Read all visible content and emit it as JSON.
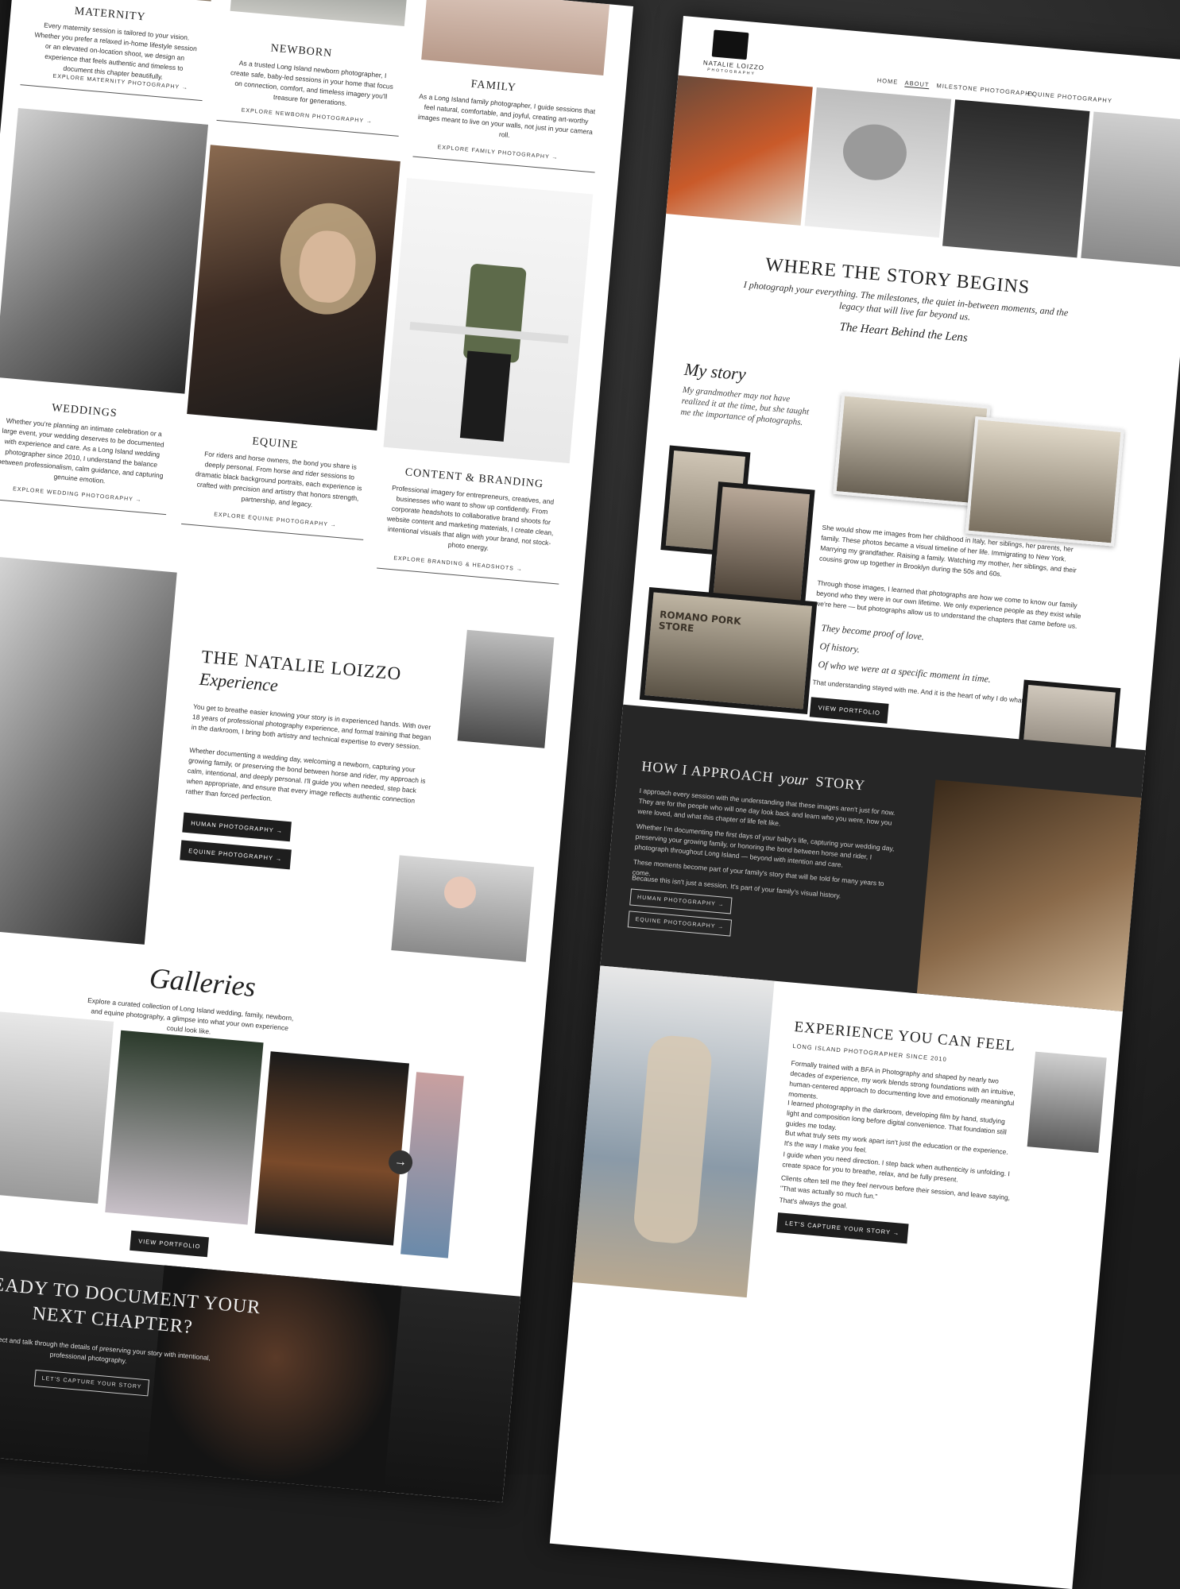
{
  "left": {
    "services_top": [
      {
        "title": "MATERNITY",
        "desc": "Every maternity session is tailored to your vision. Whether you prefer a relaxed in-home lifestyle session or an elevated on-location shoot, we design an experience that feels authentic and timeless to document this chapter beautifully.",
        "link": "EXPLORE MATERNITY PHOTOGRAPHY →"
      },
      {
        "title": "NEWBORN",
        "desc": "As a trusted Long Island newborn photographer, I create safe, baby-led sessions in your home that focus on connection, comfort, and timeless imagery you'll treasure for generations.",
        "link": "EXPLORE NEWBORN PHOTOGRAPHY →"
      },
      {
        "title": "FAMILY",
        "desc": "As a Long Island family photographer, I guide sessions that feel natural, comfortable, and joyful, creating art-worthy images meant to live on your walls, not just in your camera roll.",
        "link": "EXPLORE FAMILY PHOTOGRAPHY →"
      }
    ],
    "services_bottom": [
      {
        "title": "WEDDINGS",
        "desc": "Whether you're planning an intimate celebration or a large event, your wedding deserves to be documented with experience and care. As a Long Island wedding photographer since 2010, I understand the balance between professionalism, calm guidance, and capturing genuine emotion.",
        "link": "EXPLORE WEDDING PHOTOGRAPHY →"
      },
      {
        "title": "EQUINE",
        "desc": "For riders and horse owners, the bond you share is deeply personal. From horse and rider sessions to dramatic black background portraits, each experience is crafted with precision and artistry that honors strength, partnership, and legacy.",
        "link": "EXPLORE EQUINE PHOTOGRAPHY →"
      },
      {
        "title": "CONTENT & BRANDING",
        "desc": "Professional imagery for entrepreneurs, creatives, and businesses who want to show up confidently. From corporate headshots to collaborative brand shoots for website content and marketing materials, I create clean, intentional visuals that align with your brand, not stock-photo energy.",
        "link": "EXPLORE BRANDING & HEADSHOTS →"
      }
    ],
    "experience": {
      "title": "THE NATALIE LOIZZO",
      "subtitle": "Experience",
      "p1": "You get to breathe easier knowing your story is in experienced hands. With over 18 years of professional photography experience, and formal training that began in the darkroom, I bring both artistry and technical expertise to every session.",
      "p2": "Whether documenting a wedding day, welcoming a newborn, capturing your growing family, or preserving the bond between horse and rider, my approach is calm, intentional, and deeply personal. I'll guide you when needed, step back when appropriate, and ensure that every image reflects authentic connection rather than forced perfection.",
      "btn1": "HUMAN PHOTOGRAPHY →",
      "btn2": "EQUINE PHOTOGRAPHY →"
    },
    "galleries": {
      "title": "Galleries",
      "desc": "Explore a curated collection of Long Island wedding, family, newborn, and equine photography, a glimpse into what your own experience could look like.",
      "btn": "VIEW PORTFOLIO",
      "arrow": "→"
    },
    "cta": {
      "title1": "READY TO DOCUMENT YOUR",
      "title2": "NEXT CHAPTER?",
      "desc": "Let's connect and talk through the details of preserving your story with intentional, professional photography.",
      "btn": "LET'S CAPTURE YOUR STORY"
    }
  },
  "right": {
    "logo_name": "NATALIE LOIZZO",
    "logo_sub": "PHOTOGRAPHY",
    "nav": [
      "HOME",
      "ABOUT",
      "MILESTONE PHOTOGRAPHY",
      "EQUINE PHOTOGRAPHY"
    ],
    "hero": {
      "title": "WHERE THE STORY BEGINS",
      "subtitle": "I photograph your everything. The milestones, the quiet in-between moments, and the legacy that will live far beyond us.",
      "script": "The Heart Behind the Lens"
    },
    "story": {
      "title": "My story",
      "lead": "My grandmother may not have realized it at the time, but she taught me the importance of photographs.",
      "p1": "She would show me images from her childhood in Italy, her siblings, her parents, her family. These photos became a visual timeline of her life. Immigrating to New York. Marrying my grandfather. Raising a family. Watching my mother, her siblings, and their cousins grow up together in Brooklyn during the 50s and 60s.",
      "p2": "Through those images, I learned that photographs are how we come to know our family beyond who they were in our own lifetime. We only experience people as they exist while we're here — but photographs allow us to understand the chapters that came before us.",
      "q1": "They become proof of love.",
      "q2": "Of history.",
      "q3": "Of who we were at a specific moment in time.",
      "close": "That understanding stayed with me. And it is the heart of why I do what I do today.",
      "btn": "VIEW PORTFOLIO",
      "sign": "ROMANO PORK STORE"
    },
    "approach": {
      "title1": "HOW I APPROACH",
      "title2": "your",
      "title3": "STORY",
      "p1": "I approach every session with the understanding that these images aren't just for now. They are for the people who will one day look back and learn who you were, how you were loved, and what this chapter of life felt like.",
      "p2": "Whether I'm documenting the first days of your baby's life, capturing your wedding day, preserving your growing family, or honoring the bond between horse and rider, I photograph throughout Long Island — beyond with intention and care.",
      "p3": "These moments become part of your family's story that will be told for many years to come.",
      "p4": "Because this isn't just a session. It's part of your family's visual history.",
      "btn1": "HUMAN PHOTOGRAPHY →",
      "btn2": "EQUINE PHOTOGRAPHY →"
    },
    "feel": {
      "title": "EXPERIENCE YOU CAN FEEL",
      "tag": "LONG ISLAND PHOTOGRAPHER SINCE 2010",
      "p1": "Formally trained with a BFA in Photography and shaped by nearly two decades of experience, my work blends strong foundations with an intuitive, human-centered approach to documenting love and emotionally meaningful moments.",
      "p2": "I learned photography in the darkroom, developing film by hand, studying light and composition long before digital convenience. That foundation still guides me today.",
      "p3": "But what truly sets my work apart isn't just the education or the experience. It's the way I make you feel.",
      "p4": "I guide when you need direction. I step back when authenticity is unfolding. I create space for you to breathe, relax, and be fully present.",
      "p5": "Clients often tell me they feel nervous before their session, and leave saying, \"That was actually so much fun.\"",
      "p6": "That's always the goal.",
      "btn": "LET'S CAPTURE YOUR STORY →"
    }
  }
}
